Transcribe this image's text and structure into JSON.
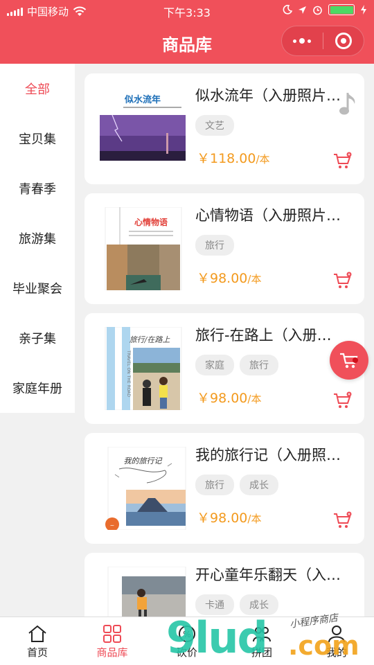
{
  "status_bar": {
    "carrier": "中国移动",
    "time": "下午3:33"
  },
  "header": {
    "title": "商品库"
  },
  "sidebar": {
    "items": [
      {
        "label": "全部",
        "active": true
      },
      {
        "label": "宝贝集"
      },
      {
        "label": "青春季"
      },
      {
        "label": "旅游集"
      },
      {
        "label": "毕业聚会"
      },
      {
        "label": "亲子集"
      },
      {
        "label": "家庭年册"
      }
    ]
  },
  "products": [
    {
      "name": "似水流年（入册照片…",
      "tags": [
        "文艺"
      ],
      "price": "￥118.00",
      "unit": "/本",
      "cover_text": "似水流年"
    },
    {
      "name": "心情物语（入册照片…",
      "tags": [
        "旅行"
      ],
      "price": "￥98.00",
      "unit": "/本",
      "cover_text": "心情物语"
    },
    {
      "name": "旅行-在路上（入册…",
      "tags": [
        "家庭",
        "旅行"
      ],
      "price": "￥98.00",
      "unit": "/本",
      "cover_text": "旅行/在路上",
      "cover_side_text": "TRAVEL ON THE ROAD"
    },
    {
      "name": "我的旅行记（入册照…",
      "tags": [
        "旅行",
        "成长"
      ],
      "price": "￥98.00",
      "unit": "/本",
      "cover_text": "我的旅行记"
    },
    {
      "name": "开心童年乐翻天（入…",
      "tags": [
        "卡通",
        "成长"
      ],
      "price": "",
      "unit": ""
    }
  ],
  "tabbar": {
    "items": [
      {
        "label": "首页",
        "icon": "home-icon"
      },
      {
        "label": "商品库",
        "icon": "grid-icon",
        "active": true
      },
      {
        "label": "砍价",
        "icon": "bargain-icon"
      },
      {
        "label": "拼团",
        "icon": "group-icon"
      },
      {
        "label": "我的",
        "icon": "user-icon"
      }
    ]
  },
  "watermark": {
    "main": "9lud",
    "suffix": ".com",
    "sub": "小程序商店"
  },
  "colors": {
    "brand": "#f0505a",
    "accent_text": "#ee4a55",
    "price": "#f39a1e",
    "battery": "#4cd964"
  }
}
